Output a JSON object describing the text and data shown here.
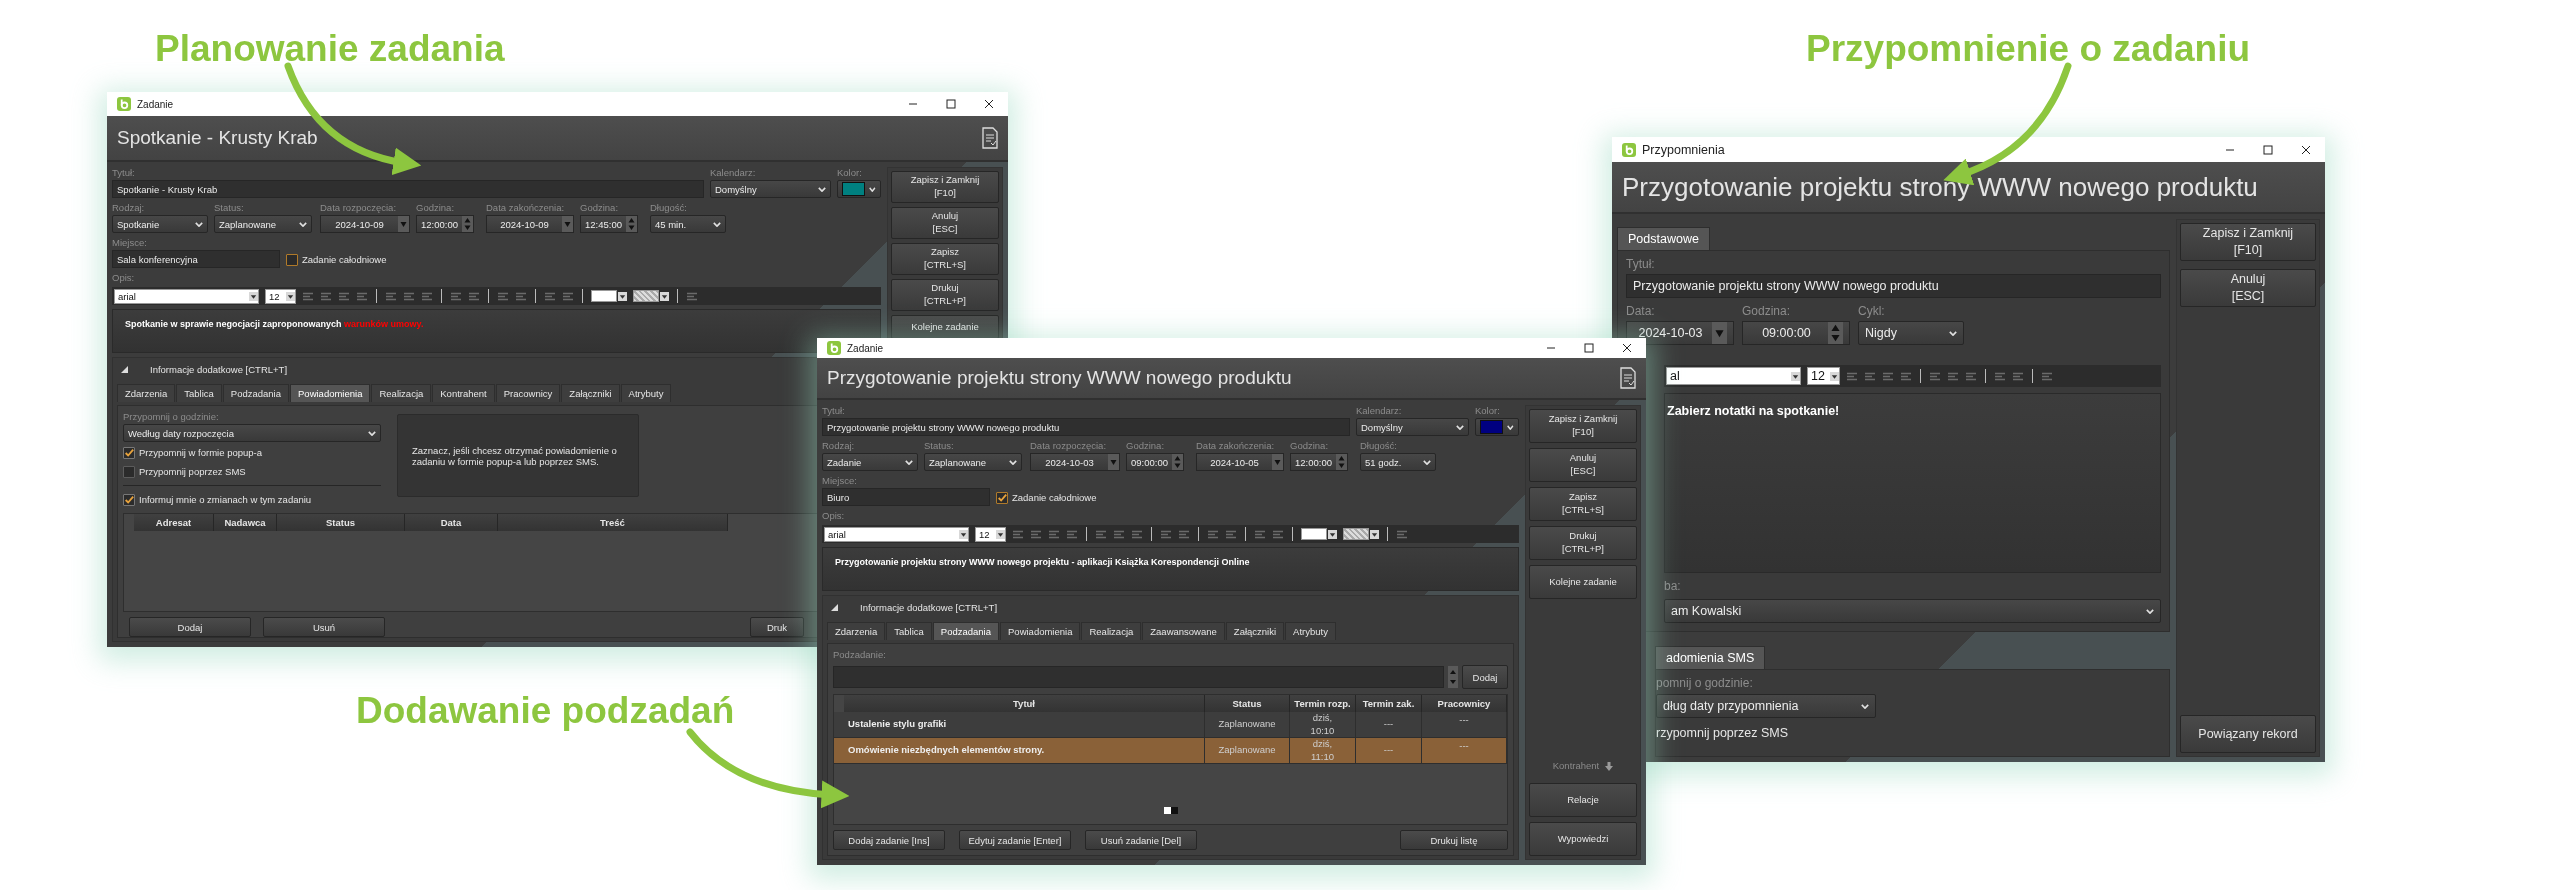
{
  "captions": [
    {
      "text": "Planowanie zadania"
    },
    {
      "text": "Przypomnienie o zadaniu"
    },
    {
      "text": "Dodawanie podzadań"
    }
  ],
  "task_window": {
    "window_title": "Zadanie",
    "header": "Spotkanie - Krusty Krab",
    "rows": [
      {
        "fields": [
          {
            "label": "Tytuł:",
            "value": "Spotkanie - Krusty Krab",
            "kind": "text"
          },
          {
            "label": "Kalendarz:",
            "value": "Domyślny",
            "kind": "select"
          },
          {
            "label": "Kolor:",
            "color": "#008080",
            "kind": "color"
          }
        ]
      },
      {
        "fields": [
          {
            "label": "Rodzaj:",
            "value": "Spotkanie",
            "kind": "select"
          },
          {
            "label": "Status:",
            "value": "Zaplanowane",
            "kind": "select"
          },
          {
            "label": "Data rozpoczęcia:",
            "value": "2024-10-09",
            "kind": "date"
          },
          {
            "label": "Godzina:",
            "value": "12:00:00",
            "kind": "time"
          },
          {
            "label": "Data zakończenia:",
            "value": "2024-10-09",
            "kind": "date"
          },
          {
            "label": "Godzina:",
            "value": "12:45:00",
            "kind": "time"
          },
          {
            "label": "Długość:",
            "value": "45 min.",
            "kind": "select"
          }
        ]
      },
      {
        "fields": [
          {
            "label": "Miejsce:",
            "value": "Sala konferencyjna",
            "kind": "text"
          },
          {
            "label": "Zadanie całodniowe",
            "checked": false,
            "kind": "checkbox"
          }
        ]
      }
    ],
    "description_label": "Opis:",
    "editor": {
      "font": "arial",
      "size": "12",
      "text": [
        {
          "text": "Spotkanie w sprawie negocjacji zaproponowanych "
        },
        {
          "text": "warunków umowy.",
          "color": "#ff0000"
        }
      ]
    },
    "info": {
      "label": "Informacje dodatkowe [CTRL+T]",
      "expanded": true,
      "tabs": [
        {
          "label": "Zdarzenia",
          "selected": false
        },
        {
          "label": "Tablica",
          "selected": false
        },
        {
          "label": "Podzadania",
          "selected": false
        },
        {
          "label": "Powiadomienia",
          "selected": true
        },
        {
          "label": "Realizacja",
          "selected": false
        },
        {
          "label": "Kontrahent",
          "selected": false
        },
        {
          "label": "Pracownicy",
          "selected": false
        },
        {
          "label": "Załączniki",
          "selected": false
        },
        {
          "label": "Atrybuty",
          "selected": false
        }
      ],
      "panel": {
        "kind": "notifications",
        "reminder_label": "Przypomnij o godzinie:",
        "reminder_value": "Według daty rozpoczęcia",
        "options": [
          {
            "label": "Przypomnij w formie popup-a",
            "checked": true
          },
          {
            "label": "Przypomnij poprzez SMS",
            "checked": false
          },
          {
            "label": "Informuj mnie o zmianach w tym zadaniu",
            "checked": true
          }
        ],
        "hint": "Zaznacz, jeśli chcesz otrzymać powiadomienie o zadaniu w formie popup-a lub poprzez SMS.",
        "columns": [
          "Adresat",
          "Nadawca",
          "Status",
          "Data",
          "Treść"
        ],
        "buttons": [
          "Dodaj",
          "Usuń",
          "Druk"
        ]
      }
    },
    "side_buttons": [
      {
        "label": "Zapisz i Zamknij",
        "shortcut": "[F10]"
      },
      {
        "label": "Anuluj",
        "shortcut": "[ESC]"
      },
      {
        "label": "Zapisz",
        "shortcut": "[CTRL+S]"
      },
      {
        "label": "Drukuj",
        "shortcut": "[CTRL+P]"
      },
      {
        "label": "Kolejne zadanie"
      }
    ]
  },
  "subtask_window": {
    "window_title": "Zadanie",
    "header": "Przygotowanie projektu strony WWW nowego produktu",
    "rows": [
      {
        "fields": [
          {
            "label": "Tytuł:",
            "value": "Przygotowanie projektu strony WWW nowego produktu",
            "kind": "text"
          },
          {
            "label": "Kalendarz:",
            "value": "Domyślny",
            "kind": "select"
          },
          {
            "label": "Kolor:",
            "color": "#000080",
            "kind": "color"
          }
        ]
      },
      {
        "fields": [
          {
            "label": "Rodzaj:",
            "value": "Zadanie",
            "kind": "select"
          },
          {
            "label": "Status:",
            "value": "Zaplanowane",
            "kind": "select"
          },
          {
            "label": "Data rozpoczęcia:",
            "value": "2024-10-03",
            "kind": "date"
          },
          {
            "label": "Godzina:",
            "value": "09:00:00",
            "kind": "time"
          },
          {
            "label": "Data zakończenia:",
            "value": "2024-10-05",
            "kind": "date"
          },
          {
            "label": "Godzina:",
            "value": "12:00:00",
            "kind": "time"
          },
          {
            "label": "Długość:",
            "value": "51 godz.",
            "kind": "select"
          }
        ]
      },
      {
        "fields": [
          {
            "label": "Miejsce:",
            "value": "Biuro",
            "kind": "text"
          },
          {
            "label": "Zadanie całodniowe",
            "checked": true,
            "kind": "checkbox"
          }
        ]
      }
    ],
    "description_label": "Opis:",
    "editor": {
      "font": "arial",
      "size": "12",
      "text": [
        {
          "text": "Przygotowanie projektu strony WWW nowego projektu - aplikacji Książka Korespondencji Online"
        }
      ]
    },
    "info": {
      "label": "Informacje dodatkowe [CTRL+T]",
      "expanded": true,
      "tabs": [
        {
          "label": "Zdarzenia",
          "selected": false
        },
        {
          "label": "Tablica",
          "selected": false
        },
        {
          "label": "Podzadania",
          "selected": true
        },
        {
          "label": "Powiadomienia",
          "selected": false
        },
        {
          "label": "Realizacja",
          "selected": false
        },
        {
          "label": "Zaawansowane",
          "selected": false
        },
        {
          "label": "Załączniki",
          "selected": false
        },
        {
          "label": "Atrybuty",
          "selected": false
        }
      ],
      "panel": {
        "kind": "subtasks",
        "subtask_label": "Podzadanie:",
        "add_button": "Dodaj",
        "columns": [
          "Tytuł",
          "Status",
          "Termin rozp.",
          "Termin zak.",
          "Pracownicy"
        ],
        "rows": [
          {
            "cells": [
              "Ustalenie stylu grafiki",
              "Zaplanowane",
              "dziś,\n10:10",
              "---",
              "---"
            ],
            "selected": false
          },
          {
            "cells": [
              "Omówienie niezbędnych elementów strony.",
              "Zaplanowane",
              "dziś,\n11:10",
              "---",
              "---"
            ],
            "selected": true
          }
        ],
        "buttons": [
          "Dodaj zadanie [Ins]",
          "Edytuj zadanie [Enter]",
          "Usuń zadanie [Del]",
          "Drukuj listę"
        ]
      }
    },
    "side_buttons": [
      {
        "label": "Zapisz i Zamknij",
        "shortcut": "[F10]"
      },
      {
        "label": "Anuluj",
        "shortcut": "[ESC]"
      },
      {
        "label": "Zapisz",
        "shortcut": "[CTRL+S]"
      },
      {
        "label": "Drukuj",
        "shortcut": "[CTRL+P]"
      },
      {
        "label": "Kolejne zadanie"
      }
    ],
    "side_bottom": [
      {
        "label": "Kontrahent",
        "disabled": true
      },
      {
        "label": "Relacje",
        "disabled": false
      },
      {
        "label": "Wypowiedzi",
        "disabled": false
      }
    ]
  },
  "reminder_window": {
    "window_title": "Przypomnienia",
    "header": "Przygotowanie projektu strony WWW nowego produktu",
    "tabs": [
      {
        "label": "Podstawowe",
        "selected": true
      }
    ],
    "rows": [
      {
        "fields": [
          {
            "label": "Tytuł:",
            "value": "Przygotowanie projektu strony WWW nowego produktu",
            "kind": "text"
          }
        ]
      },
      {
        "fields": [
          {
            "label": "Data:",
            "value": "2024-10-03",
            "kind": "date"
          },
          {
            "label": "Godzina:",
            "value": "09:00:00",
            "kind": "time"
          },
          {
            "label": "Cykl:",
            "value": "Nigdy",
            "kind": "select"
          }
        ]
      }
    ],
    "editor": {
      "font": "al",
      "size": "12",
      "text": [
        {
          "text": "Zabierz notatki na spotkanie!"
        }
      ]
    },
    "person": {
      "label": "ba:",
      "value": "am Kowalski"
    },
    "sms_tabs": [
      {
        "label": "adomienia SMS",
        "selected": true
      }
    ],
    "sms_label": "pomnij o godzinie:",
    "sms_value": "dług daty przypomnienia",
    "sms_option": "rzypomnij poprzez SMS",
    "side_buttons": [
      {
        "label": "Zapisz i Zamknij",
        "shortcut": "[F10]"
      },
      {
        "label": "Anuluj",
        "shortcut": "[ESC]"
      }
    ],
    "bottom_button": "Powiązany rekord"
  }
}
